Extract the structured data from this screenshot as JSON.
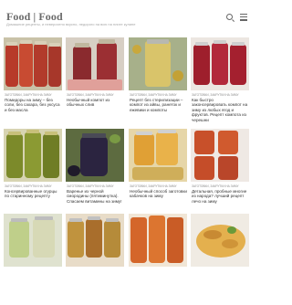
{
  "site": {
    "logo": "Food | Food",
    "tagline": "Домашние рецепты, и невероятно вкусно, недорого на всю на плите кулине"
  },
  "cards": [
    {
      "cat": "ЗАГОТОВКИ, ЗАКРУТКИ НА ЗИМУ",
      "title": "Помидоры на зиму – без соли, без сахара, без уксуса и без масла"
    },
    {
      "cat": "ЗАГОТОВКИ, ЗАКРУТКИ НА ЗИМУ",
      "title": "Необычный компот из обычных слив"
    },
    {
      "cat": "ЗАГОТОВКИ, ЗАКРУТКИ НА ЗИМУ",
      "title": "Рецепт без стерилизации – компот из айвы, ранеток и ежевики и компоты"
    },
    {
      "cat": "ЗАГОТОВКИ, ЗАКРУТКИ НА ЗИМУ",
      "title": "Как быстро законсервировать компот на зиму из любых ягод и фруктов. Рецепт компота из черешни"
    },
    {
      "cat": "ЗАГОТОВКИ, ЗАКРУТКИ НА ЗИМУ",
      "title": "Консервированные огурцы по старинному рецепту"
    },
    {
      "cat": "ЗАГОТОВКИ, ЗАКРУТКИ НА ЗИМУ",
      "title": "Варенье из черной смородины (пятиминутка). Спасаем витамины на зиму!"
    },
    {
      "cat": "ЗАГОТОВКИ, ЗАКРУТКИ НА ЗИМУ",
      "title": "Необычный способ заготовки кабачков на зиму"
    },
    {
      "cat": "ЗАГОТОВКИ, ЗАКРУТКИ НА ЗИМУ",
      "title": "Детальная, пробные многие из народа? лучший рецепт лечо на зиму"
    },
    {
      "cat": "",
      "title": ""
    },
    {
      "cat": "",
      "title": ""
    },
    {
      "cat": "",
      "title": ""
    },
    {
      "cat": "",
      "title": ""
    }
  ]
}
